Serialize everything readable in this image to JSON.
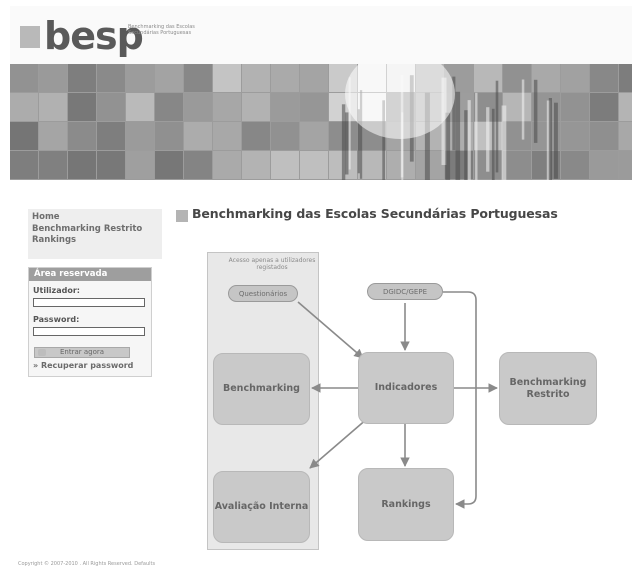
{
  "header": {
    "logo": "besp",
    "logo_subtitle": "Benchmarking das Escolas Secundárias Portuguesas"
  },
  "nav": {
    "items": [
      {
        "label": "Home"
      },
      {
        "label": "Benchmarking Restrito"
      },
      {
        "label": "Rankings"
      }
    ]
  },
  "login": {
    "title": "Área reservada",
    "username_label": "Utilizador:",
    "password_label": "Password:",
    "username_value": "",
    "password_value": "",
    "submit_label": "Entrar agora",
    "recover_label": "» Recuperar password"
  },
  "main": {
    "title": "Benchmarking das Escolas Secundárias Portuguesas"
  },
  "diagram": {
    "panel_note": "Acesso apenas a utilizadores registados",
    "nodes": {
      "questionarios": "Questionários",
      "dgidc": "DGIDC/GEPE",
      "benchmarking": "Benchmarking",
      "indicadores": "Indicadores",
      "benchmarking_restrito_line1": "Benchmarking",
      "benchmarking_restrito_line2": "Restrito",
      "avaliacao_interna": "Avaliação Interna",
      "rankings": "Rankings"
    }
  },
  "footer": {
    "text": "Copyright © 2007-2010 . All Rights Reserved. Defaults"
  },
  "colors": {
    "node_fill": "#c9c9c9",
    "panel_fill": "#e8e8e8",
    "arrow": "#8a8a8a",
    "title_bullet": "#b4b4b4",
    "login_header": "#9e9e9e"
  }
}
